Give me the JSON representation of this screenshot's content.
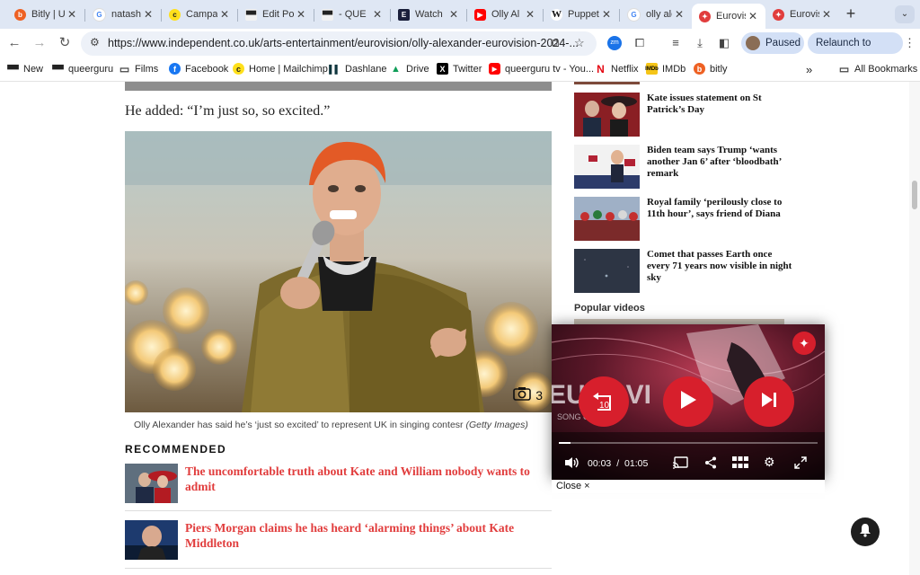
{
  "tabs": [
    {
      "title": "Bitly | U",
      "icon": "bitly-icon"
    },
    {
      "title": "natash",
      "icon": "google-icon"
    },
    {
      "title": "Campa",
      "icon": "mailchimp-icon"
    },
    {
      "title": "Edit Po",
      "icon": "queerguru-icon"
    },
    {
      "title": "- QUE",
      "icon": "queerguru-icon"
    },
    {
      "title": "Watch",
      "icon": "e-icon"
    },
    {
      "title": "Olly Al",
      "icon": "youtube-icon"
    },
    {
      "title": "Puppet",
      "icon": "wikipedia-icon"
    },
    {
      "title": "olly ale",
      "icon": "google-icon"
    },
    {
      "title": "Eurovis",
      "icon": "independent-icon",
      "active": true
    },
    {
      "title": "Eurovis",
      "icon": "independent-icon"
    }
  ],
  "toolbar": {
    "url": "https://www.independent.co.uk/arts-entertainment/eurovision/olly-alexander-eurovision-2024-...",
    "paused_label": "Paused",
    "relaunch_label": "Relaunch to update"
  },
  "bookmarks": {
    "items": [
      {
        "label": "New",
        "icon": "queerguru-icon"
      },
      {
        "label": "queerguru",
        "icon": "queerguru-icon"
      },
      {
        "label": "Films",
        "icon": "folder-icon"
      },
      {
        "label": "Facebook",
        "icon": "facebook-icon"
      },
      {
        "label": "Home | Mailchimp",
        "icon": "mailchimp-icon"
      },
      {
        "label": "Dashlane",
        "icon": "dashlane-icon"
      },
      {
        "label": "Drive",
        "icon": "drive-icon"
      },
      {
        "label": "Twitter",
        "icon": "x-icon"
      },
      {
        "label": "queerguru tv - You...",
        "icon": "youtube-icon"
      },
      {
        "label": "Netflix",
        "icon": "netflix-icon"
      },
      {
        "label": "IMDb",
        "icon": "imdb-icon"
      },
      {
        "label": "bitly",
        "icon": "bitly-icon"
      }
    ],
    "overflow": "»",
    "all_label": "All Bookmarks"
  },
  "article": {
    "quote": "He added: “I’m just so, so excited.”",
    "photo_count": "3",
    "caption": "Olly Alexander has said he’s ‘just so excited’ to represent UK in singing contesr",
    "caption_credit": "(Getty Images)"
  },
  "recommended": {
    "heading": "RECOMMENDED",
    "items": [
      {
        "title": "The uncomfortable truth about Kate and William nobody wants to admit"
      },
      {
        "title": "Piers Morgan claims he has heard ‘alarming things’ about Kate Middleton"
      }
    ]
  },
  "sidebar": {
    "items": [
      {
        "title": "Kate issues statement on St Patrick’s Day"
      },
      {
        "title": "Biden team says Trump ‘wants another Jan 6’ after ‘bloodbath’ remark"
      },
      {
        "title": "Royal family ‘perilously close to 11th hour’, says friend of Diana"
      },
      {
        "title": "Comet that passes Earth once every 71 years now visible in night sky"
      }
    ],
    "popular_heading": "Popular videos"
  },
  "player": {
    "rewind_label": "10",
    "current_time": "00:03",
    "separator": "/",
    "duration": "01:05",
    "progress": 0.046,
    "close_label": "Close ×"
  },
  "colors": {
    "accent_red": "#e13d3d",
    "player_red": "#d71f2c",
    "tabstrip": "#dfe7f4"
  }
}
